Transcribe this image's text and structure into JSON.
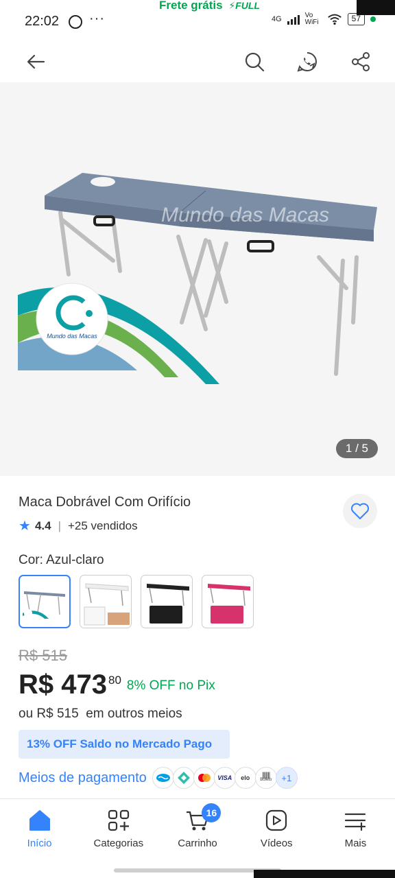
{
  "status": {
    "time": "22:02",
    "dots": "···",
    "promo": "Frete grátis",
    "promo_badge": "FULL",
    "network": "4G",
    "vowifi": "Vo WiFi",
    "battery": "57"
  },
  "product": {
    "title": "Maca Dobrável Com Orifício",
    "rating": "4.4",
    "sold": "+25 vendidos",
    "image_counter": "1 / 5",
    "watermark": "Mundo das Macas",
    "logo_text": "Mundo das Macas",
    "color_label": "Cor: Azul-claro",
    "swatches": [
      {
        "color": "#7a8ca3",
        "selected": true
      },
      {
        "color": "#f2f2f2",
        "selected": false
      },
      {
        "color": "#222222",
        "selected": false
      },
      {
        "color": "#d6336c",
        "selected": false
      }
    ]
  },
  "pricing": {
    "old_price": "R$ 515",
    "price_main": "R$ 473",
    "price_cents": "80",
    "pix_off": "8% OFF no Pix",
    "other_methods": "ou R$ 515  em outros meios",
    "mp_badge": "13% OFF Saldo no Mercado Pago",
    "payment_link": "Meios de pagamento",
    "payment_icons": [
      "mercado-pago",
      "pix",
      "mastercard",
      "VISA",
      "elo",
      "Boleto"
    ],
    "more_methods": "+1"
  },
  "bottom_nav": [
    {
      "label": "Início",
      "icon": "home-icon",
      "active": true
    },
    {
      "label": "Categorias",
      "icon": "categories-icon",
      "active": false
    },
    {
      "label": "Carrinho",
      "icon": "cart-icon",
      "active": false,
      "badge": "16"
    },
    {
      "label": "Vídeos",
      "icon": "video-icon",
      "active": false
    },
    {
      "label": "Mais",
      "icon": "more-icon",
      "active": false
    }
  ],
  "colors": {
    "accent": "#3483fa",
    "success": "#00a650"
  }
}
